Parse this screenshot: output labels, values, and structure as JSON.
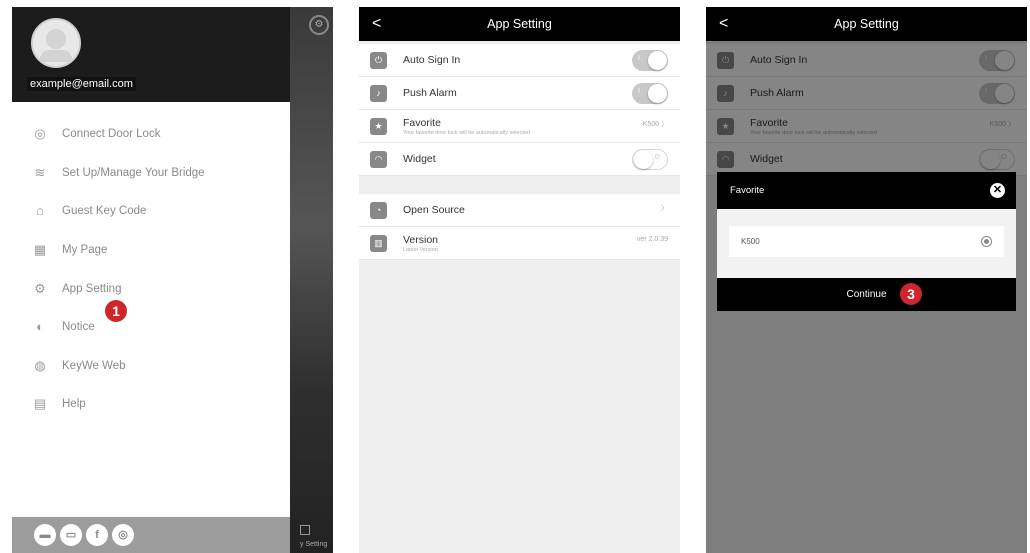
{
  "panel1": {
    "email": "example@email.com",
    "menu": [
      {
        "label": "Connect Door Lock",
        "icon": "◎"
      },
      {
        "label": "Set Up/Manage Your Bridge",
        "icon": "≋"
      },
      {
        "label": "Guest Key Code",
        "icon": "⌂"
      },
      {
        "label": "My Page",
        "icon": "▦"
      },
      {
        "label": "App Setting",
        "icon": "⚙"
      },
      {
        "label": "Notice",
        "icon": "◐"
      },
      {
        "label": "KeyWe Web",
        "icon": "◍"
      },
      {
        "label": "Help",
        "icon": "▤"
      }
    ],
    "social": [
      "▬",
      "▭",
      "f",
      "◎"
    ],
    "step_badge": "1",
    "dock_label": "y Setting"
  },
  "panel2": {
    "title": "App Setting",
    "back": "<",
    "rows": [
      {
        "label": "Auto Sign In",
        "icon": "⏻",
        "toggle_text": "I",
        "on": true
      },
      {
        "label": "Push Alarm",
        "icon": "♪",
        "toggle_text": "I",
        "on": true
      },
      {
        "label": "Favorite",
        "sub": "Your favorite door lock will be automatically selected",
        "icon": "★",
        "value": "K500  〉"
      },
      {
        "label": "Widget",
        "icon": "◠",
        "toggle_text": "O",
        "on": false
      }
    ],
    "rows2": [
      {
        "label": "Open Source",
        "icon": "◔",
        "value": "〉"
      },
      {
        "label": "Version",
        "sub": "Latest Version",
        "icon": "▥",
        "value": "ver 2.0.39"
      }
    ]
  },
  "panel3": {
    "title": "App Setting",
    "back": "<",
    "dialog": {
      "title": "Favorite",
      "close": "✕",
      "option": "K500",
      "button": "Continue"
    },
    "step_badge": "3"
  }
}
